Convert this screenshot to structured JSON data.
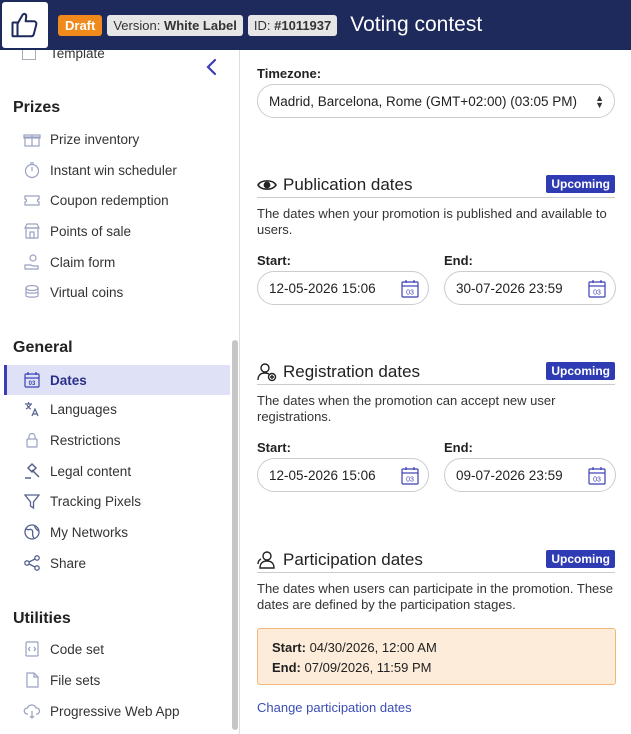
{
  "header": {
    "draft": "Draft",
    "version_prefix": "Version: ",
    "version_value": "White Label",
    "id_prefix": "ID: ",
    "id_value": "#1011937",
    "title": "Voting contest"
  },
  "sidebar": {
    "partial_item": "Template",
    "sections": [
      {
        "title": "Prizes",
        "items": [
          "Prize inventory",
          "Instant win scheduler",
          "Coupon redemption",
          "Points of sale",
          "Claim form",
          "Virtual coins"
        ]
      },
      {
        "title": "General",
        "items": [
          "Dates",
          "Languages",
          "Restrictions",
          "Legal content",
          "Tracking Pixels",
          "My Networks",
          "Share"
        ]
      },
      {
        "title": "Utilities",
        "items": [
          "Code set",
          "File sets",
          "Progressive Web App"
        ]
      }
    ],
    "active_item": "Dates"
  },
  "main": {
    "timezone_label": "Timezone:",
    "timezone_value": "Madrid, Barcelona, Rome (GMT+02:00) (03:05 PM)",
    "publication": {
      "title": "Publication dates",
      "badge": "Upcoming",
      "description": "The dates when your promotion is published and available to users.",
      "start_label": "Start:",
      "end_label": "End:",
      "start_value": "12-05-2026 15:06",
      "end_value": "30-07-2026 23:59"
    },
    "registration": {
      "title": "Registration dates",
      "badge": "Upcoming",
      "description": "The dates when the promotion can accept new user registrations.",
      "start_label": "Start:",
      "end_label": "End:",
      "start_value": "12-05-2026 15:06",
      "end_value": "09-07-2026 23:59"
    },
    "participation": {
      "title": "Participation dates",
      "badge": "Upcoming",
      "description": "The dates when users can participate in the promotion. These dates are defined by the participation stages.",
      "start_label": "Start:",
      "start_value": "04/30/2026, 12:00 AM",
      "end_label": "End:",
      "end_value": "07/09/2026, 11:59 PM",
      "link": "Change participation dates"
    },
    "calendar_day": "03"
  },
  "colors": {
    "header_bg": "#1f2a5c",
    "draft_badge": "#f08a1c",
    "accent": "#2e3bb3",
    "active_bg": "#dfe2f7",
    "info_bg": "#fdecd9"
  }
}
